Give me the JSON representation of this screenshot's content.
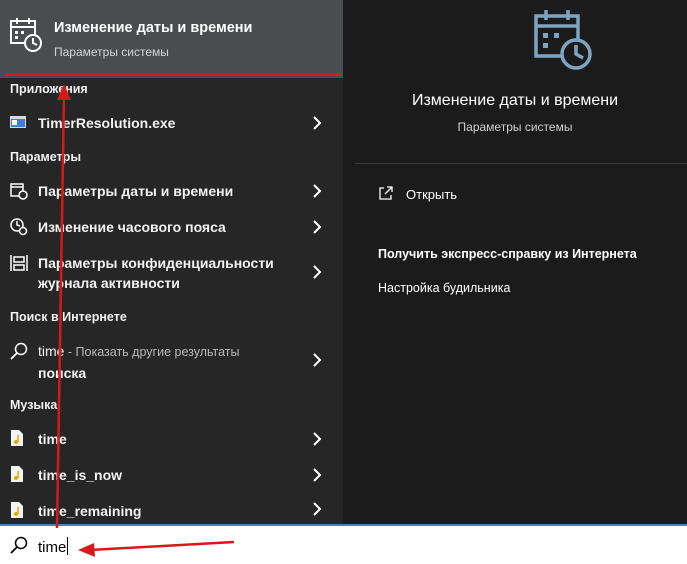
{
  "best_match": {
    "title": "Изменение даты и времени",
    "subtitle": "Параметры системы",
    "icon": "calendar-clock-icon"
  },
  "sections": {
    "apps": "Приложения",
    "settings": "Параметры",
    "web": "Поиск в Интернете",
    "music": "Музыка"
  },
  "apps": [
    {
      "label": "TimerResolution.exe",
      "icon": "app-exe-icon"
    }
  ],
  "settings": [
    {
      "label": "Параметры даты и времени",
      "icon": "calendar-clock-icon"
    },
    {
      "label": "Изменение часового пояса",
      "icon": "clock-globe-icon"
    },
    {
      "label_line1": "Параметры конфиденциальности",
      "label_line2": "журнала активности",
      "icon": "timeline-icon"
    }
  ],
  "web": {
    "query": "time",
    "suffix_line1": " - Показать другие результаты",
    "suffix_line2": "поиска",
    "icon": "search-icon"
  },
  "music": [
    {
      "label": "time",
      "icon": "music-file-icon"
    },
    {
      "label": "time_is_now",
      "icon": "music-file-icon"
    },
    {
      "label": "time_remaining",
      "icon": "music-file-icon"
    }
  ],
  "preview": {
    "title": "Изменение даты и времени",
    "subtitle": "Параметры системы",
    "open_label": "Открыть",
    "help_title": "Получить экспресс-справку из Интернета",
    "help_link": "Настройка будильника"
  },
  "search": {
    "value": "time",
    "icon": "search-icon"
  },
  "colors": {
    "accent_red": "#d61a1a",
    "selected_bg": "#4a4d4e",
    "panel_bg": "#262626",
    "search_border": "#3d87c9"
  }
}
